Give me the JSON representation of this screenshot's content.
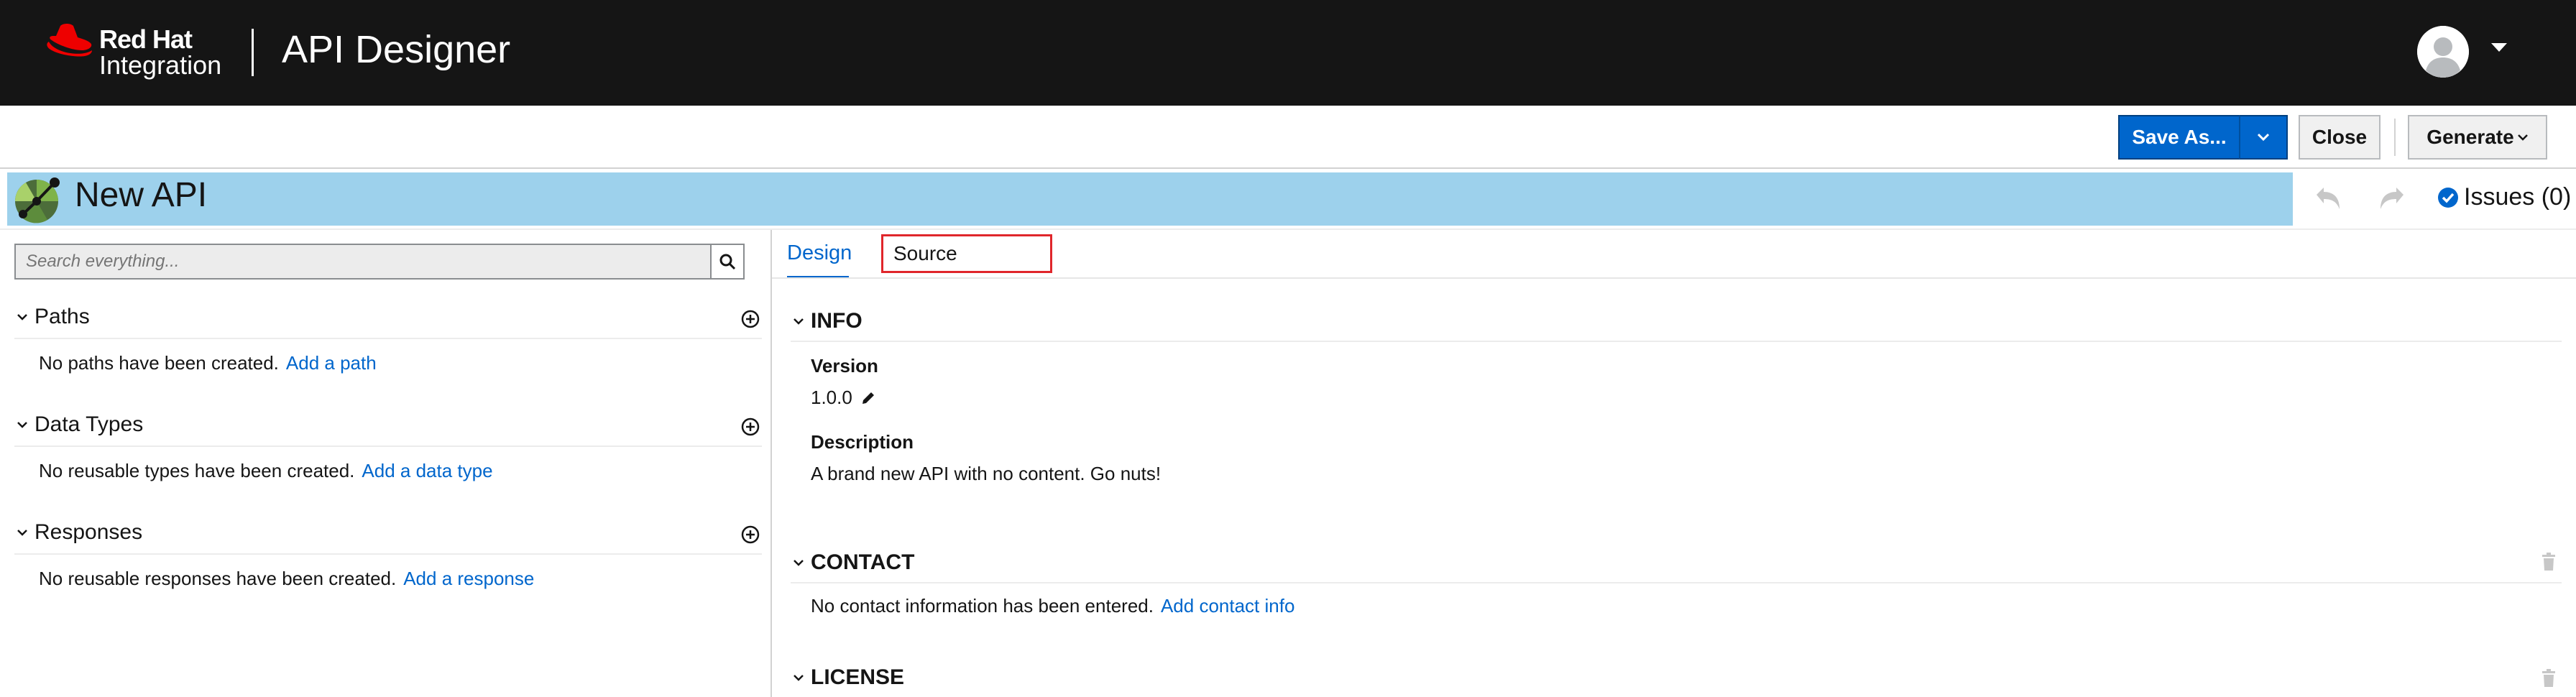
{
  "header": {
    "brand_line1": "Red Hat",
    "brand_line2": "Integration",
    "app_title": "API Designer",
    "icons": {
      "logo": "red-hat-logo-icon",
      "avatar": "user-avatar-icon",
      "caret": "caret-down-icon"
    }
  },
  "toolbar": {
    "save_as_label": "Save As...",
    "close_label": "Close",
    "generate_label": "Generate"
  },
  "titlebar": {
    "title": "New API",
    "issues_label": "Issues (0)"
  },
  "search": {
    "placeholder": "Search everything..."
  },
  "left_sections": [
    {
      "title": "Paths",
      "empty_text": "No paths have been created.",
      "link": "Add a path"
    },
    {
      "title": "Data Types",
      "empty_text": "No reusable types have been created.",
      "link": "Add a data type"
    },
    {
      "title": "Responses",
      "empty_text": "No reusable responses have been created.",
      "link": "Add a response"
    }
  ],
  "tabs": {
    "design": "Design",
    "source": "Source"
  },
  "info": {
    "title": "INFO",
    "version_label": "Version",
    "version_value": "1.0.0",
    "description_label": "Description",
    "description_value": "A brand new API with no content. Go nuts!"
  },
  "contact": {
    "title": "CONTACT",
    "empty_text": "No contact information has been entered.",
    "link": "Add contact info"
  },
  "license": {
    "title": "LICENSE"
  },
  "colors": {
    "header_bg": "#151515",
    "primary": "#0066cc",
    "title_band": "#9dd1ec",
    "highlight_box": "#e0262b",
    "brand_red": "#ee0000"
  }
}
